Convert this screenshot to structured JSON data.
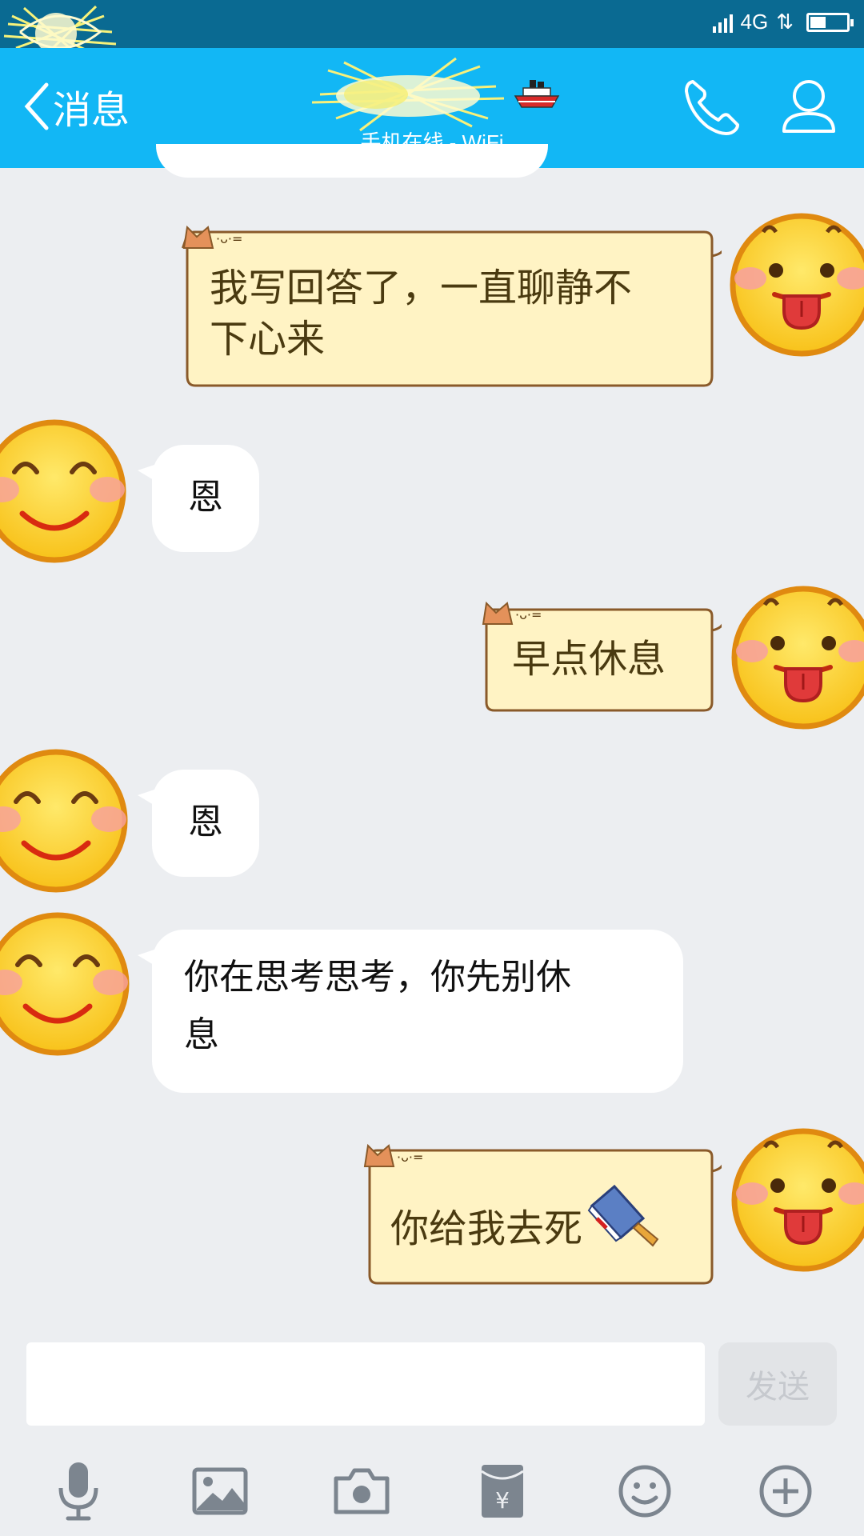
{
  "status_bar": {
    "network": "4G"
  },
  "nav": {
    "back_label": "消息",
    "subtitle": "手机在线 - WiFi",
    "accent": "#12b7f5"
  },
  "messages": [
    {
      "side": "out",
      "text_line1": "我写回答了，一直聊静不",
      "text_line2": "下心来",
      "avatar": "tongue-out-emoji-avatar"
    },
    {
      "side": "in",
      "text": "恩",
      "avatar": "smiling-emoji-avatar"
    },
    {
      "side": "out",
      "text": "早点休息",
      "avatar": "tongue-out-emoji-avatar"
    },
    {
      "side": "in",
      "text": "恩",
      "avatar": "smiling-emoji-avatar"
    },
    {
      "side": "in",
      "text_line1": "你在思考思考，你先别休",
      "text_line2": "息",
      "avatar": "smiling-emoji-avatar"
    },
    {
      "side": "out",
      "text": "你给我去死",
      "emoji": "cleaver-icon",
      "avatar": "tongue-out-emoji-avatar"
    }
  ],
  "composer": {
    "input_value": "",
    "send_label": "发送"
  },
  "toolbar": [
    "mic-icon",
    "image-icon",
    "camera-icon",
    "red-packet-icon",
    "emoji-icon",
    "plus-icon"
  ]
}
